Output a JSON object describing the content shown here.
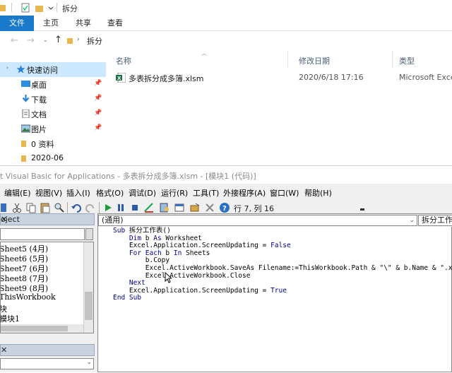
{
  "explorer": {
    "title": "拆分",
    "tabs": [
      {
        "label": "文件"
      },
      {
        "label": "主页"
      },
      {
        "label": "共享"
      },
      {
        "label": "查看"
      }
    ],
    "breadcrumb": "拆分",
    "columns": {
      "name": "名称",
      "date": "修改日期",
      "type": "类型"
    },
    "nav_items": [
      {
        "label": "快速访问",
        "icon": "star-icon",
        "pinned": false
      },
      {
        "label": "桌面",
        "icon": "desktop-icon",
        "pinned": true
      },
      {
        "label": "下载",
        "icon": "download-icon",
        "pinned": true
      },
      {
        "label": "文档",
        "icon": "document-icon",
        "pinned": true
      },
      {
        "label": "图片",
        "icon": "picture-icon",
        "pinned": true
      },
      {
        "label": "0 资料",
        "icon": "folder-icon",
        "pinned": false
      },
      {
        "label": "2020-06",
        "icon": "folder-icon",
        "pinned": false
      }
    ],
    "file": {
      "name": "多表拆分成多簿.xlsm",
      "date": "2020/6/18 17:16",
      "type": "Microsoft Excel"
    }
  },
  "vbe": {
    "title": "t Visual Basic for Applications - 多表拆分成多簿.xlsm - [模块1 (代码)]",
    "menu": [
      "编辑(E)",
      "视图(V)",
      "插入(I)",
      "格式(O)",
      "调试(D)",
      "运行(R)",
      "工具(T)",
      "外接程序(A)",
      "窗口(W)",
      "帮助(H)"
    ],
    "position": "行 7, 列 16",
    "project_title": "oject",
    "project_items": [
      "Sheet5 (4月)",
      "Sheet6 (5月)",
      "Sheet7 (6月)",
      "Sheet8 (7月)",
      "Sheet9 (8月)",
      "ThisWorkbook",
      "块",
      "模块1"
    ],
    "combo_left": "(通用)",
    "combo_right": "拆分工作",
    "code": [
      "Sub 拆分工作表()",
      "    Dim b As Worksheet",
      "    Excel.Application.ScreenUpdating = False",
      "    For Each b In Sheets",
      "        b.Copy",
      "        Excel.ActiveWorkbook.SaveAs Filename:=ThisWorkbook.Path & \"\\\" & b.Name & \".xlsx\"",
      "        Excel.ActiveWorkbook.Close",
      "    Next",
      "    Excel.Application.ScreenUpdating = True",
      "End Sub"
    ]
  },
  "colors": {
    "accent": "#1979ca",
    "selection": "#cce8ff",
    "keyword": "#00008b"
  }
}
